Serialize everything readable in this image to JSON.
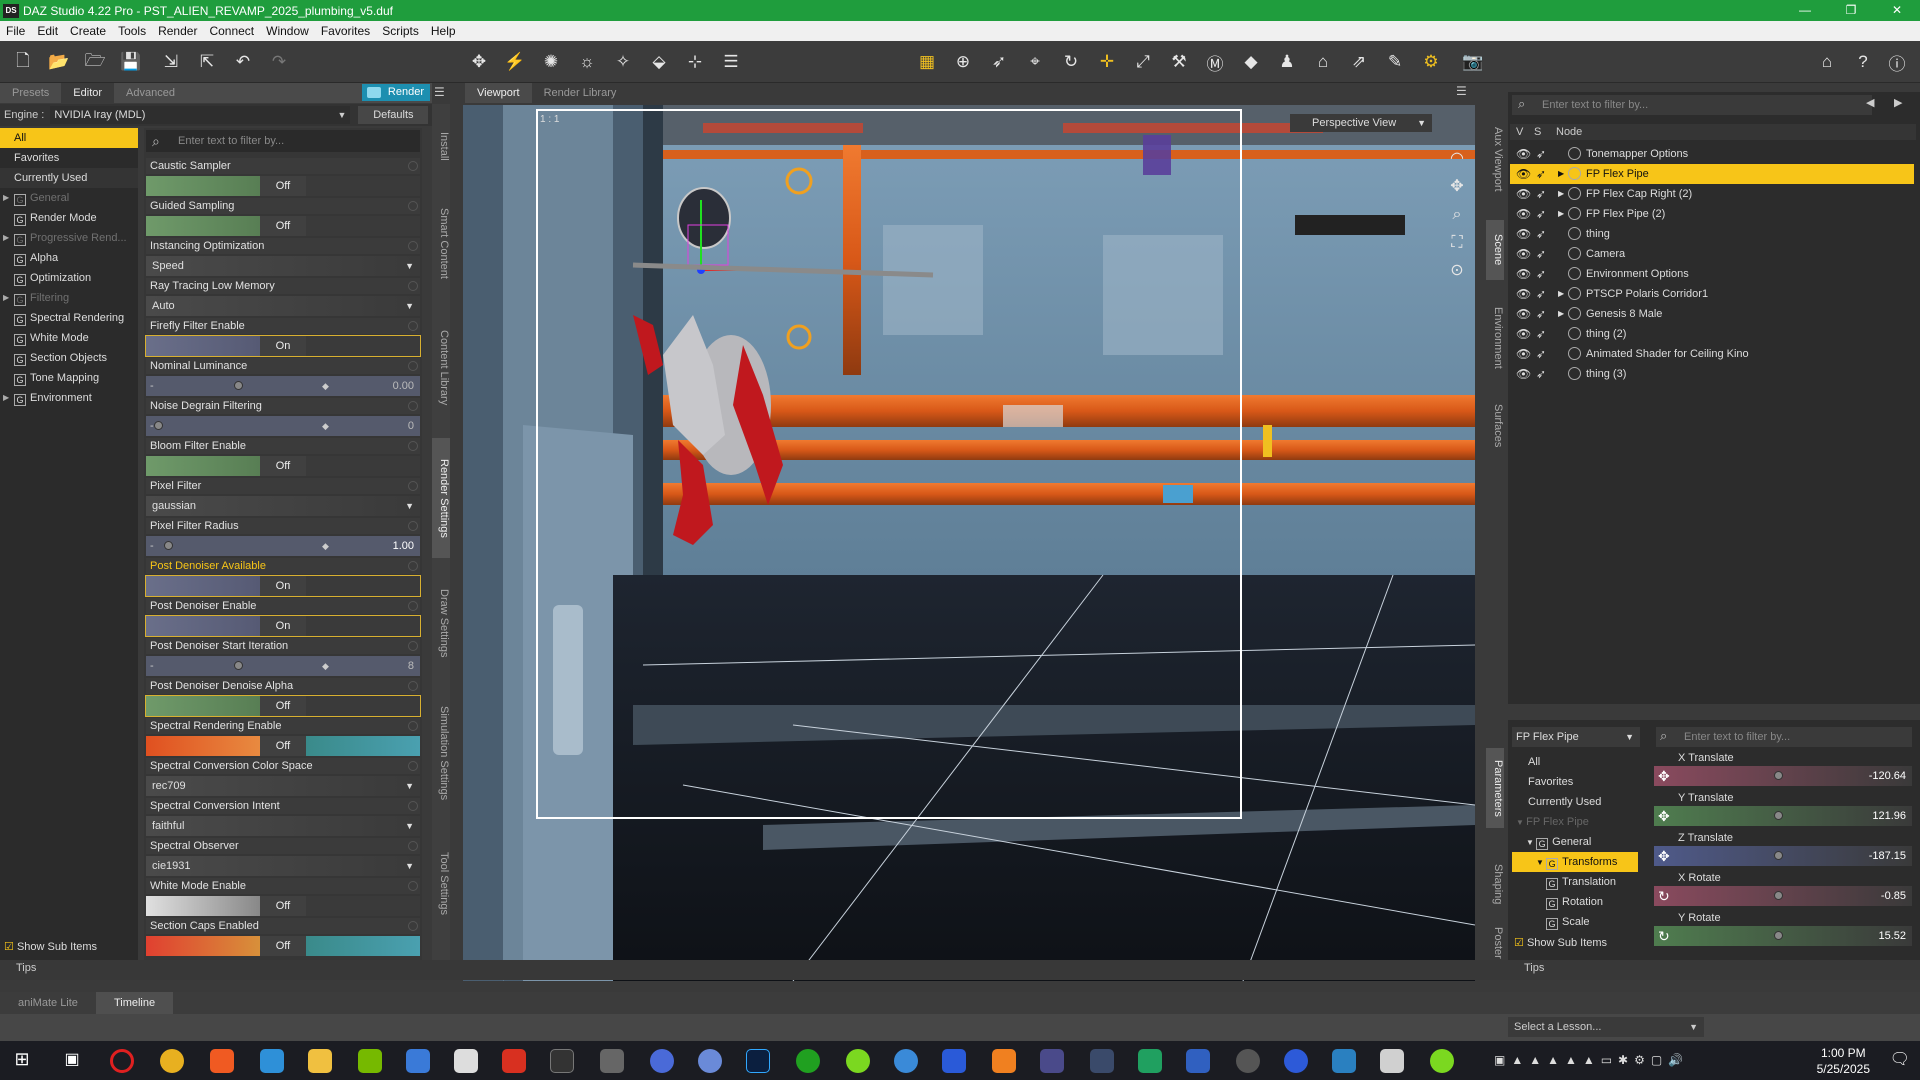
{
  "window": {
    "title": "DAZ Studio 4.22 Pro - PST_ALIEN_REVAMP_2025_plumbing_v5.duf",
    "app_icon": "DS"
  },
  "menu": [
    "File",
    "Edit",
    "Create",
    "Tools",
    "Render",
    "Connect",
    "Window",
    "Favorites",
    "Scripts",
    "Help"
  ],
  "left_panel": {
    "tabs": [
      "Presets",
      "Editor",
      "Advanced"
    ],
    "render_button": "Render",
    "engine_label": "Engine :",
    "engine_value": "NVIDIA Iray (MDL)",
    "defaults_button": "Defaults",
    "filter_placeholder": "Enter text to filter by...",
    "categories": [
      {
        "label": "All",
        "state": "selected"
      },
      {
        "label": "Favorites"
      },
      {
        "label": "Currently Used"
      },
      {
        "label": "General",
        "dim": true,
        "arrow": true,
        "group": true
      },
      {
        "label": "Render Mode",
        "group": true
      },
      {
        "label": "Progressive Rend...",
        "dim": true,
        "arrow": true,
        "group": true
      },
      {
        "label": "Alpha",
        "group": true
      },
      {
        "label": "Optimization",
        "group": true
      },
      {
        "label": "Filtering",
        "dim": true,
        "arrow": true,
        "group": true
      },
      {
        "label": "Spectral Rendering",
        "group": true
      },
      {
        "label": "White Mode",
        "group": true
      },
      {
        "label": "Section Objects",
        "group": true
      },
      {
        "label": "Tone Mapping",
        "group": true
      },
      {
        "label": "Environment",
        "arrow": true,
        "group": true
      }
    ],
    "show_sub_items": "Show Sub Items",
    "properties": [
      {
        "name": "Caustic Sampler",
        "type": "toggle",
        "value": "Off"
      },
      {
        "name": "Guided Sampling",
        "type": "toggle",
        "value": "Off"
      },
      {
        "name": "Instancing Optimization",
        "type": "dropdown",
        "value": "Speed"
      },
      {
        "name": "Ray Tracing Low Memory",
        "type": "dropdown",
        "value": "Auto"
      },
      {
        "name": "Firefly Filter Enable",
        "type": "toggle",
        "value": "On",
        "highlight": true
      },
      {
        "name": "Nominal Luminance",
        "type": "slider",
        "value": "0.00"
      },
      {
        "name": "Noise Degrain Filtering",
        "type": "slider",
        "value": "0"
      },
      {
        "name": "Bloom Filter Enable",
        "type": "toggle",
        "value": "Off"
      },
      {
        "name": "Pixel Filter",
        "type": "dropdown",
        "value": "gaussian"
      },
      {
        "name": "Pixel Filter Radius",
        "type": "slider",
        "value": "1.00"
      },
      {
        "name": "Post Denoiser Available",
        "type": "toggle",
        "value": "On",
        "highlight": true,
        "active": true
      },
      {
        "name": "Post Denoiser Enable",
        "type": "toggle",
        "value": "On",
        "highlight": true
      },
      {
        "name": "Post Denoiser Start Iteration",
        "type": "slider",
        "value": "8"
      },
      {
        "name": "Post Denoiser Denoise Alpha",
        "type": "toggle",
        "value": "Off",
        "highlight": true
      },
      {
        "name": "Spectral Rendering Enable",
        "type": "toggle",
        "value": "Off",
        "spectral": true
      },
      {
        "name": "Spectral Conversion Color Space",
        "type": "dropdown",
        "value": "rec709"
      },
      {
        "name": "Spectral Conversion Intent",
        "type": "dropdown",
        "value": "faithful"
      },
      {
        "name": "Spectral Observer",
        "type": "dropdown",
        "value": "cie1931"
      },
      {
        "name": "White Mode Enable",
        "type": "toggle",
        "value": "Off",
        "white": true
      },
      {
        "name": "Section Caps Enabled",
        "type": "toggle",
        "value": "Off",
        "spectral": true
      }
    ],
    "side_tabs": [
      "Install",
      "Smart Content",
      "Content Library",
      "Render Settings",
      "Draw Settings",
      "Simulation Settings",
      "Tool Settings"
    ]
  },
  "viewport": {
    "tabs": [
      "Viewport",
      "Render Library"
    ],
    "view_label": "Perspective View",
    "ratio": "1 : 1"
  },
  "scene": {
    "filter_placeholder": "Enter text to filter by...",
    "headers": [
      "V",
      "S",
      "Node"
    ],
    "nodes": [
      {
        "label": "Tonemapper Options"
      },
      {
        "label": "FP Flex Pipe",
        "selected": true,
        "arrow": true
      },
      {
        "label": "FP Flex Cap Right (2)",
        "arrow": true
      },
      {
        "label": "FP Flex Pipe (2)",
        "arrow": true
      },
      {
        "label": "thing"
      },
      {
        "label": "Camera"
      },
      {
        "label": "Environment Options"
      },
      {
        "label": "PTSCP Polaris Corridor1",
        "arrow": true
      },
      {
        "label": "Genesis 8 Male",
        "arrow": true
      },
      {
        "label": "thing (2)"
      },
      {
        "label": "Animated Shader for Ceiling Kino"
      },
      {
        "label": "thing (3)"
      }
    ],
    "side_tabs": [
      "Aux Viewport",
      "Scene",
      "Environment",
      "Surfaces"
    ]
  },
  "parameters": {
    "selected_node": "FP Flex Pipe",
    "filter_placeholder": "Enter text to filter by...",
    "groups": [
      {
        "label": "All"
      },
      {
        "label": "Favorites"
      },
      {
        "label": "Currently Used"
      },
      {
        "label": "FP Flex Pipe",
        "dim": true,
        "indent": 0
      },
      {
        "label": "General",
        "indent": 1,
        "group": true
      },
      {
        "label": "Transforms",
        "indent": 2,
        "group": true,
        "selected": true
      },
      {
        "label": "Translation",
        "indent": 3,
        "group": true
      },
      {
        "label": "Rotation",
        "indent": 3,
        "group": true
      },
      {
        "label": "Scale",
        "indent": 3,
        "group": true
      }
    ],
    "show_sub_items": "Show Sub Items",
    "transforms": [
      {
        "name": "X Translate",
        "value": "-120.64",
        "color": "#8a4a5e"
      },
      {
        "name": "Y Translate",
        "value": "121.96",
        "color": "#4f7d4f"
      },
      {
        "name": "Z Translate",
        "value": "-187.15",
        "color": "#4f5a8a"
      },
      {
        "name": "X Rotate",
        "value": "-0.85",
        "color": "#8a4a5e"
      },
      {
        "name": "Y Rotate",
        "value": "15.52",
        "color": "#4f7d4f"
      }
    ],
    "side_tabs": [
      "Parameters",
      "Shaping",
      "Poster"
    ]
  },
  "bottom": {
    "tips": "Tips",
    "anim_tabs": [
      "aniMate Lite",
      "Timeline"
    ],
    "lesson": "Select a Lesson..."
  },
  "taskbar": {
    "time": "1:00 PM",
    "date": "5/25/2025"
  },
  "colors": {
    "accent": "#f7c518",
    "title_green": "#1f9d3d",
    "render_blue": "#1d8fb0"
  }
}
